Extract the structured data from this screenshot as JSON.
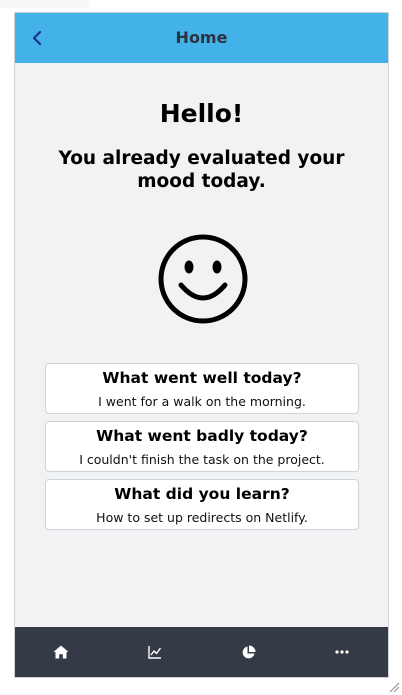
{
  "header": {
    "title": "Home",
    "back_icon": "chevron-left-icon"
  },
  "main": {
    "greeting": "Hello!",
    "status": "You already evaluated your mood today.",
    "mood_icon": "smiley-face-icon"
  },
  "cards": [
    {
      "title": "What went well today?",
      "text": "I went for a walk on the morning."
    },
    {
      "title": "What went badly today?",
      "text": "I couldn't finish the task on the project."
    },
    {
      "title": "What did you learn?",
      "text": "How to set up redirects on Netlify."
    }
  ],
  "tabbar": {
    "items": [
      {
        "icon": "home-icon"
      },
      {
        "icon": "chart-line-icon"
      },
      {
        "icon": "pie-chart-icon"
      },
      {
        "icon": "more-icon"
      }
    ]
  },
  "colors": {
    "header_bg": "#42b2e8",
    "tabbar_bg": "#343a46",
    "page_bg": "#f0f2f4",
    "back_icon": "#1f2d8c"
  }
}
